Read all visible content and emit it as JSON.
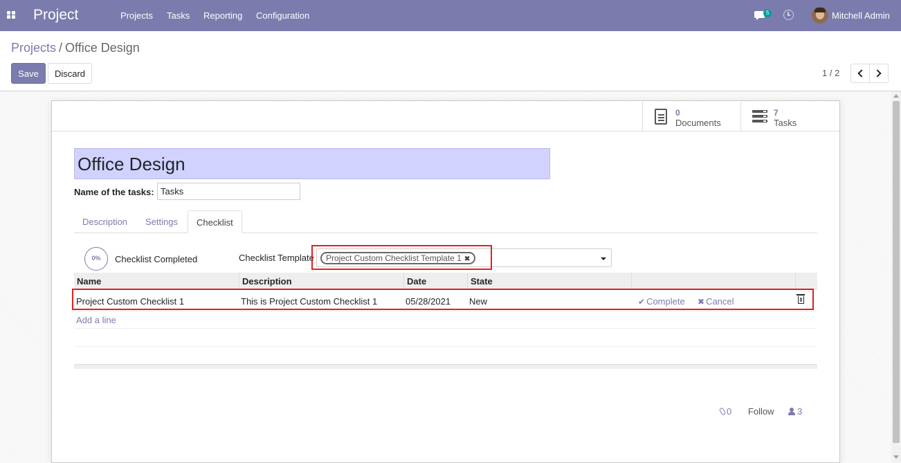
{
  "navbar": {
    "brand": "Project",
    "menu": [
      "Projects",
      "Tasks",
      "Reporting",
      "Configuration"
    ],
    "messages_count": "5",
    "user_name": "Mitchell Admin",
    "background_color": "#7c7bad"
  },
  "breadcrumb": {
    "parent": "Projects",
    "separator": "/",
    "current": "Office Design"
  },
  "toolbar": {
    "save_label": "Save",
    "discard_label": "Discard"
  },
  "pager": {
    "value": "1 / 2"
  },
  "stat_buttons": {
    "documents": {
      "value": "0",
      "label": "Documents",
      "icon": "file-text-icon"
    },
    "tasks": {
      "value": "7",
      "label": "Tasks",
      "icon": "tasks-icon"
    }
  },
  "form": {
    "project_name": "Office Design",
    "tasks_label": "Name of the tasks:",
    "tasks_value": "Tasks"
  },
  "tabs": [
    "Description",
    "Settings",
    "Checklist"
  ],
  "active_tab": "Checklist",
  "checklist": {
    "progress": "0%",
    "completed_label": "Checklist Completed",
    "template_label": "Checklist Template",
    "template_tag": "Project Custom Checklist Template 1"
  },
  "table": {
    "columns": [
      "Name",
      "Description",
      "Date",
      "State"
    ],
    "rows": [
      {
        "name": "Project Custom Checklist 1",
        "description": "This is Project Custom Checklist 1",
        "date": "05/28/2021",
        "state": "New",
        "complete_label": "Complete",
        "cancel_label": "Cancel"
      }
    ],
    "add_line": "Add a line"
  },
  "chatter": {
    "attachments": "0",
    "follow_label": "Follow",
    "followers": "3"
  },
  "highlight_color": "#e02020"
}
